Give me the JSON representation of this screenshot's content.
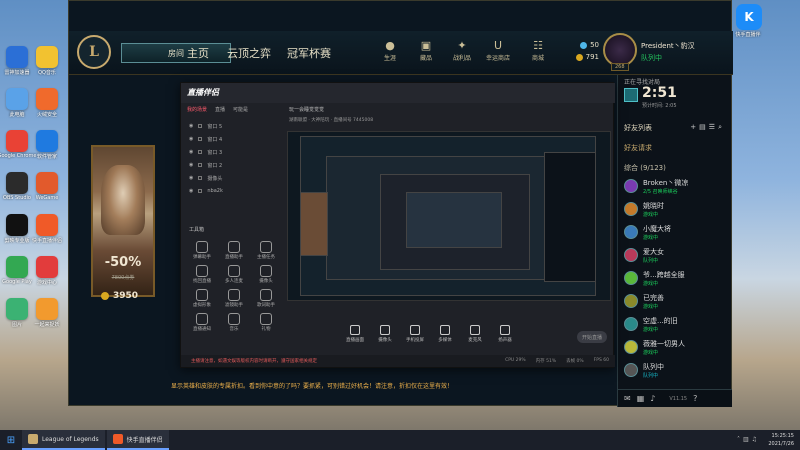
{
  "desktop": {
    "icons_left": [
      {
        "label": "雷神加速器",
        "color": "#2b6fd6"
      },
      {
        "label": "QQ音乐",
        "color": "#f2c230"
      },
      {
        "label": "此电脑",
        "color": "#5aa2e8"
      },
      {
        "label": "火绒安全",
        "color": "#f06a2c"
      },
      {
        "label": "Google Chrome",
        "color": "#e94235"
      },
      {
        "label": "软件管家",
        "color": "#1f7ae0"
      },
      {
        "label": "OBS Studio",
        "color": "#2b2b2b"
      },
      {
        "label": "WeGame",
        "color": "#e25a2c"
      },
      {
        "label": "剪映专业版",
        "color": "#111111"
      },
      {
        "label": "快手直播伴侣",
        "color": "#f05a28"
      },
      {
        "label": "Google Play",
        "color": "#33a852"
      },
      {
        "label": "游戏中心",
        "color": "#e23c3c"
      },
      {
        "label": "图片",
        "color": "#3bb273"
      },
      {
        "label": "一起来捉妖",
        "color": "#f29a2e"
      }
    ],
    "top_right_icon": {
      "glyph": "K",
      "label": "快手直播伴"
    }
  },
  "lol": {
    "logo": "L",
    "play_button": "房间",
    "nav": [
      "主页",
      "云顶之弈",
      "冠军杯赛"
    ],
    "right_nav": [
      {
        "label": "生涯",
        "icon": "person-icon"
      },
      {
        "label": "藏品",
        "icon": "chest-icon"
      },
      {
        "label": "战利品",
        "icon": "loot-icon"
      },
      {
        "label": "幸运商店",
        "icon": "shop-icon"
      },
      {
        "label": "商城",
        "icon": "store-icon"
      }
    ],
    "currency": {
      "rp": "50",
      "be": "791"
    },
    "profile": {
      "name": "President丶豹汉",
      "status": "队列中",
      "level": "268"
    },
    "champion": {
      "discount": "-50%",
      "old_price": "7800点券",
      "price": "3950"
    },
    "ticker": "显示英雄和皮肤的专属折扣。看到你中意的了吗？要抓紧，可别错过好机会！请注意，折扣仅在这里有效！",
    "friends": {
      "queue_label": "正在寻找对局",
      "queue_time": "2:51",
      "queue_sub": "预计时间: 2:05",
      "header": "好友列表",
      "requests": "好友请求",
      "group": "综合 (9/123)",
      "list": [
        {
          "name": "Broken丶微凉",
          "status": "2/5 召唤师峡谷",
          "color": "green",
          "avatar": "#7a3bb0"
        },
        {
          "name": "姚晓时",
          "status": "游戏中",
          "color": "green",
          "avatar": "#c47a2a"
        },
        {
          "name": "小魔大将",
          "status": "游戏中",
          "color": "green",
          "avatar": "#3a7ab8"
        },
        {
          "name": "爱大女",
          "status": "队列中",
          "color": "green",
          "avatar": "#b83a5a"
        },
        {
          "name": "爷...跨越全服",
          "status": "游戏中",
          "color": "green",
          "avatar": "#5ab83a"
        },
        {
          "name": "已完善",
          "status": "游戏中",
          "color": "green",
          "avatar": "#8a8a2a"
        },
        {
          "name": "空虚...的旧",
          "status": "游戏中",
          "color": "green",
          "avatar": "#2a8a8a"
        },
        {
          "name": "薇雅一切男人",
          "status": "游戏中",
          "color": "green",
          "avatar": "#b8b83a"
        },
        {
          "name": "队列中",
          "status": "队列中",
          "color": "teal",
          "avatar": "#555555"
        }
      ],
      "version": "V11.15"
    }
  },
  "streamer": {
    "title": "直播伴侣",
    "tabs": [
      "我的场景",
      "直播",
      "可能是"
    ],
    "scenes": [
      "窗口 5",
      "窗口 4",
      "窗口 3",
      "窗口 2",
      "摄像头",
      "nba2k"
    ],
    "tools_title": "工具箱",
    "tools": [
      "弹幕助手",
      "直播助手",
      "主播任务",
      "找回直播",
      "多人连麦",
      "摄像头",
      "虚拟形象",
      "滤镜助手",
      "歌词助手",
      "直播通知",
      "音乐",
      "礼物"
    ],
    "room": "玩一会睡觉觉觉",
    "room_meta": "湖南联盟 · 大神陪玩 · 直播间号 7445008",
    "controls": [
      "直播画面",
      "摄像头",
      "手机投屏",
      "多媒体",
      "麦克风",
      "扬声器"
    ],
    "start_live": "开始直播",
    "status_warn": "主播请注意，如遇文娱等版权内容时请断开，遵守国家相关规定",
    "stats": [
      "CPU 29%",
      "内存 51%",
      "丢帧 0%",
      "FPS 60"
    ]
  },
  "taskbar": {
    "items": [
      {
        "label": "League of Legends",
        "color": "#c8aa6e"
      },
      {
        "label": "快手直播伴侣",
        "color": "#f05a28"
      }
    ],
    "time": "15:25:15",
    "date": "2021/7/26"
  }
}
